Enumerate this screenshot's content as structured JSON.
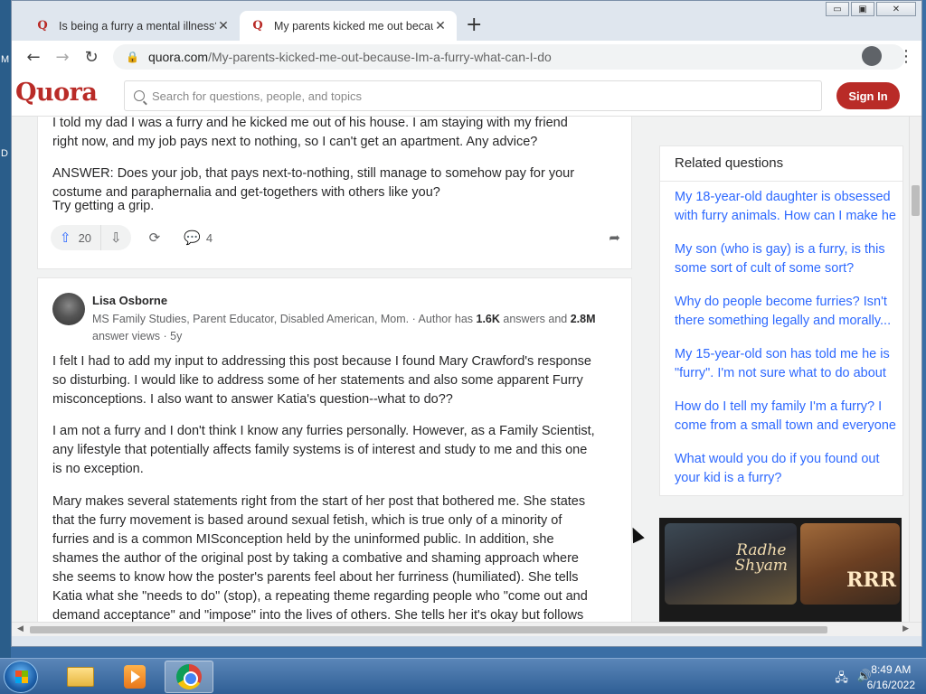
{
  "desktop": {
    "edge_letters": [
      "M",
      "D"
    ]
  },
  "window": {
    "min": "▭",
    "max": "▣",
    "close": "✕"
  },
  "tabs": [
    {
      "title": "Is being a furry a mental illness?",
      "favicon": "Q",
      "close": "✕"
    },
    {
      "title": "My parents kicked me out becau",
      "favicon": "Q",
      "close": "✕"
    }
  ],
  "new_tab": "+",
  "toolbar": {
    "back": "←",
    "forward": "→",
    "reload": "↻",
    "url_domain": "quora.com",
    "url_path": "/My-parents-kicked-me-out-because-Im-a-furry-what-can-I-do",
    "share": "⇪",
    "star": "☆",
    "menu": "⋮"
  },
  "header": {
    "logo": "Quora",
    "search_placeholder": "Search for questions, people, and topics",
    "signin": "Sign In"
  },
  "answer1": {
    "p1_line1": "I told my dad I was a furry and he kicked me out of his house. I am staying with my friend",
    "p1_line2": "right now, and my job pays next to nothing, so I can't get an apartment. Any advice?",
    "p2_line1": "ANSWER: Does your job, that pays next-to-nothing, still manage to somehow pay for your",
    "p2_line2": "costume and paraphernalia and get-togethers with others like you?",
    "p3": "Try getting a grip.",
    "upvotes": "20",
    "comments": "4"
  },
  "answer2": {
    "author": "Lisa Osborne",
    "cred_pre": "MS Family Studies, Parent Educator, Disabled American, Mom. · Author has ",
    "cred_answers": "1.6K",
    "cred_mid": " answers and ",
    "cred_views": "2.8M",
    "cred_line2": "answer views · 5y",
    "p1": [
      "I felt I had to add my input to addressing this post because I found Mary Crawford's response",
      "so disturbing. I would like to address some of her statements and also some apparent Furry",
      "misconceptions. I also want to answer Katia's question--what to do??"
    ],
    "p2": [
      "I am not a furry and I don't think I know any furries personally. However, as a Family Scientist,",
      "any lifestyle that potentially affects family systems is of interest and study to me and this one",
      "is no exception."
    ],
    "p3": [
      "Mary makes several statements right from the start of her post that bothered me. She states",
      "that the furry movement is based around sexual fetish, which is true only of a minority of",
      "furries and is a common MISconception held by the uninformed public. In addition, she",
      "shames the author of the original post by taking a combative and shaming approach where",
      "she seems to know how the poster's parents feel about her furriness (humiliated). She tells",
      "Katia what she \"needs to do\" (stop), a repeating theme regarding people who \"come out and",
      "demand acceptance\" and \"impose\" into the lives of others. She tells her it's okay but follows"
    ]
  },
  "related": {
    "title": "Related questions",
    "items": [
      [
        "My 18-year-old daughter is obsessed",
        "with furry animals. How can I make he"
      ],
      [
        "My son (who is gay) is a furry, is this",
        "some sort of cult of some sort?"
      ],
      [
        "Why do people become furries? Isn't",
        "there something legally and morally..."
      ],
      [
        "My 15-year-old son has told me he is",
        "\"furry\". I'm not sure what to do about"
      ],
      [
        "How do I tell my family I'm a furry? I",
        "come from a small town and everyone"
      ],
      [
        "What would you do if you found out",
        "your kid is a furry?"
      ]
    ]
  },
  "ad": {
    "tile1": "Radhe\nShyam",
    "tile2": "RRR"
  },
  "taskbar": {
    "time": "8:49 AM",
    "date": "6/16/2022",
    "tray_network": "🖧",
    "tray_volume": "🔊"
  }
}
